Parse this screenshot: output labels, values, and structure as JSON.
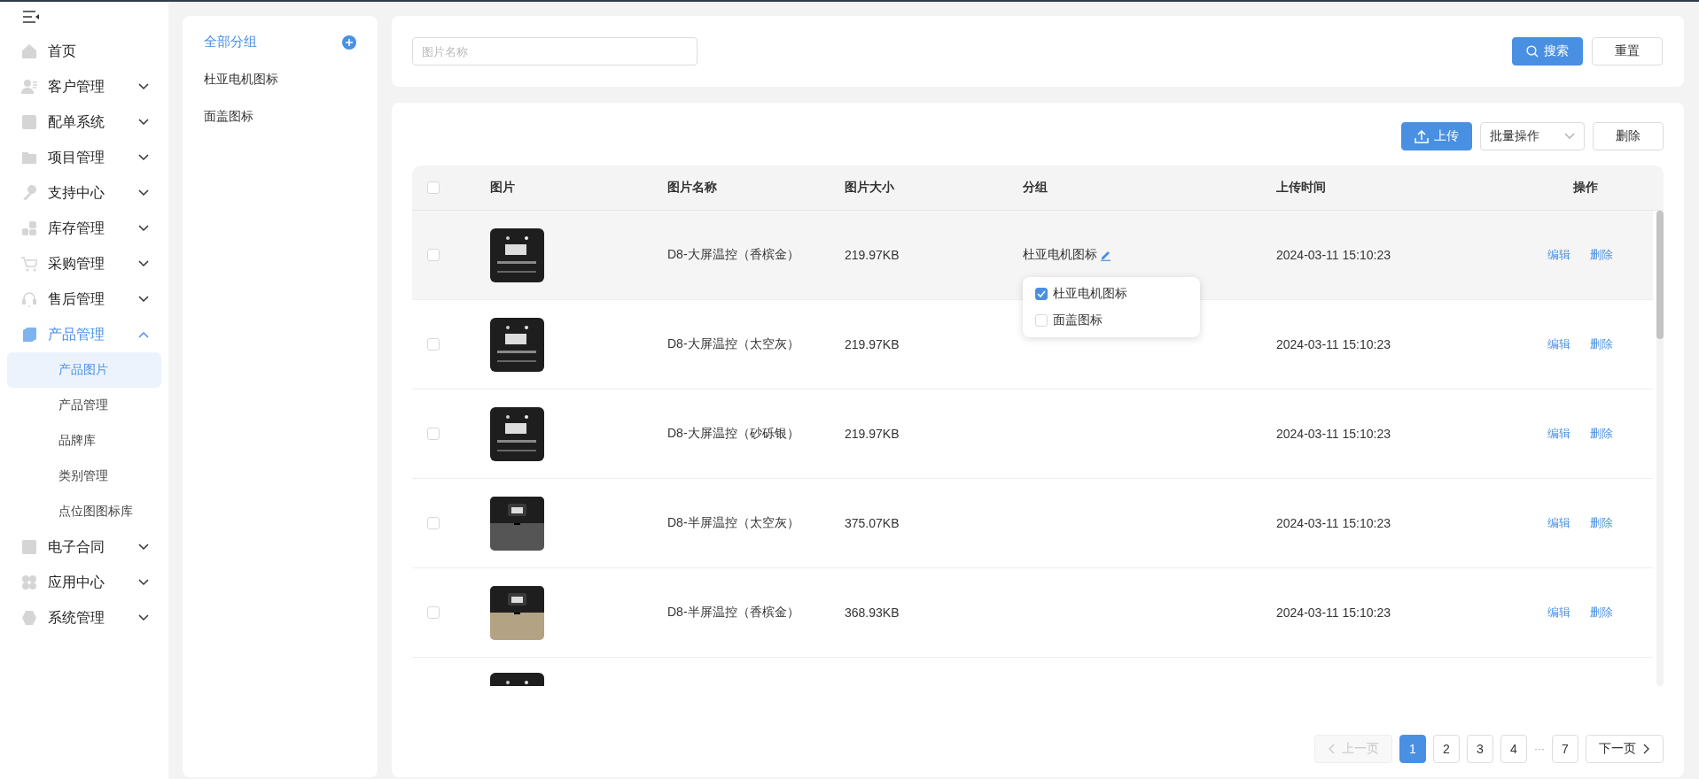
{
  "sidebar": {
    "items": [
      {
        "label": "首页"
      },
      {
        "label": "客户管理",
        "expanded": false
      },
      {
        "label": "配单系统",
        "expanded": false
      },
      {
        "label": "项目管理",
        "expanded": false
      },
      {
        "label": "支持中心",
        "expanded": false
      },
      {
        "label": "库存管理",
        "expanded": false
      },
      {
        "label": "采购管理",
        "expanded": false
      },
      {
        "label": "售后管理",
        "expanded": false
      },
      {
        "label": "产品管理",
        "expanded": true,
        "children": [
          {
            "label": "产品图片",
            "selected": true
          },
          {
            "label": "产品管理",
            "selected": false
          },
          {
            "label": "品牌库",
            "selected": false
          },
          {
            "label": "类别管理",
            "selected": false
          },
          {
            "label": "点位图图标库",
            "selected": false
          }
        ]
      },
      {
        "label": "电子合同",
        "expanded": false
      },
      {
        "label": "应用中心",
        "expanded": false
      },
      {
        "label": "系统管理",
        "expanded": false
      }
    ]
  },
  "groups": {
    "all_label": "全部分组",
    "items": [
      {
        "label": "杜亚电机图标",
        "selected": false
      },
      {
        "label": "面盖图标",
        "selected": false
      }
    ]
  },
  "search": {
    "placeholder": "图片名称",
    "search_button": "搜索",
    "reset_button": "重置"
  },
  "toolbar": {
    "upload_button": "上传",
    "batch_select": "批量操作",
    "delete_button": "删除"
  },
  "table": {
    "header_checked": false,
    "columns": [
      "图片",
      "图片名称",
      "图片大小",
      "分组",
      "上传时间",
      "操作"
    ],
    "rows": [
      {
        "thumb": {
          "kind": "picture"
        },
        "name": "D8-大屏温控（香槟金）",
        "size": "219.97KB",
        "group": "杜亚电机图标",
        "time": "2024-03-11 15:10:23",
        "hovered": true,
        "checked": false,
        "actions": [
          "编辑",
          "删除"
        ]
      },
      {
        "thumb": {
          "kind": "picture"
        },
        "name": "D8-大屏温控（太空灰）",
        "size": "219.97KB",
        "time": "2024-03-11 15:10:23",
        "checked": false,
        "actions": [
          "编辑",
          "删除"
        ]
      },
      {
        "thumb": {
          "kind": "picture"
        },
        "name": "D8-大屏温控（砂砾银）",
        "size": "219.97KB",
        "time": "2024-03-11 15:10:23",
        "checked": false,
        "actions": [
          "编辑",
          "删除"
        ]
      },
      {
        "thumb": {
          "kind": "picture"
        },
        "name": "D8-半屏温控（太空灰）",
        "size": "375.07KB",
        "time": "2024-03-11 15:10:23",
        "checked": false,
        "actions": [
          "编辑",
          "删除"
        ]
      },
      {
        "thumb": {
          "kind": "picture"
        },
        "name": "D8-半屏温控（香槟金）",
        "size": "368.93KB",
        "time": "2024-03-11 15:10:23",
        "checked": false,
        "actions": [
          "编辑",
          "删除"
        ]
      },
      {
        "thumb": {
          "kind": "picture"
        }
      }
    ]
  },
  "group_popup": {
    "options": [
      {
        "label": "杜亚电机图标",
        "checked": true
      },
      {
        "label": "面盖图标",
        "checked": false
      }
    ]
  },
  "pagination": {
    "prev": "上一页",
    "prev_disabled": true,
    "pages": [
      {
        "label": "1",
        "selected": true
      },
      {
        "label": "2",
        "selected": false
      },
      {
        "label": "3",
        "selected": false
      },
      {
        "label": "4",
        "selected": false
      },
      {
        "label": "···",
        "kind": "ellipsis"
      },
      {
        "label": "7",
        "selected": false
      }
    ],
    "next": "下一页"
  }
}
